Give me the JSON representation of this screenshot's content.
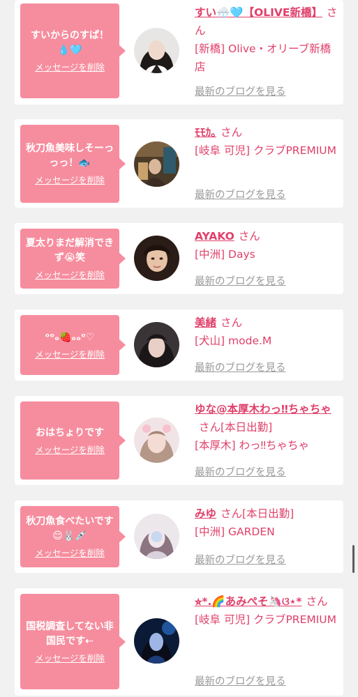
{
  "feed": {
    "delete_label": "メッセージを削除",
    "honorific": "さん",
    "blog_link_label": "最新のブログを見る",
    "accent_color": "#f68d9e",
    "text_color": "#e0406a",
    "posts": [
      {
        "message": "すいからのすぱ！\n💧🩵",
        "name": "すい🌨️🩵【OLIVE新橋】",
        "status": "",
        "shop": "[新橋] Olive・オリーブ新橋店"
      },
      {
        "message": "秋刀魚美味しそーっっっ！🐟",
        "name": "ﾓﾓｶ｡",
        "status": "",
        "shop": "[岐阜 可児] クラブPREMIUM"
      },
      {
        "message": "夏太りまだ解消できず😭笑",
        "name": "AYAKO",
        "status": "",
        "shop": "[中洲] Days"
      },
      {
        "message": "ᵒᵒₒ🍓ₒₒᵒ♡",
        "name": "美緒",
        "status": "",
        "shop": "[犬山] mode.M"
      },
      {
        "message": "おはちょりです",
        "name": "ゆな@本厚木わっ‼︎ちゃちゃ",
        "status": "[本日出勤]",
        "shop": "[本厚木] わっ‼︎ちゃちゃ"
      },
      {
        "message": "秋刀魚食べたいです😌🐰💉",
        "name": "みゆ",
        "status": "[本日出勤]",
        "shop": "[中洲] GARDEN"
      },
      {
        "message": "国税調査してない非国民です⇠",
        "name": "⭐︎*.🌈あみぺそ🦄ଓ⋆*",
        "status": "",
        "shop": "[岐阜 可児] クラブPREMIUM"
      }
    ]
  }
}
